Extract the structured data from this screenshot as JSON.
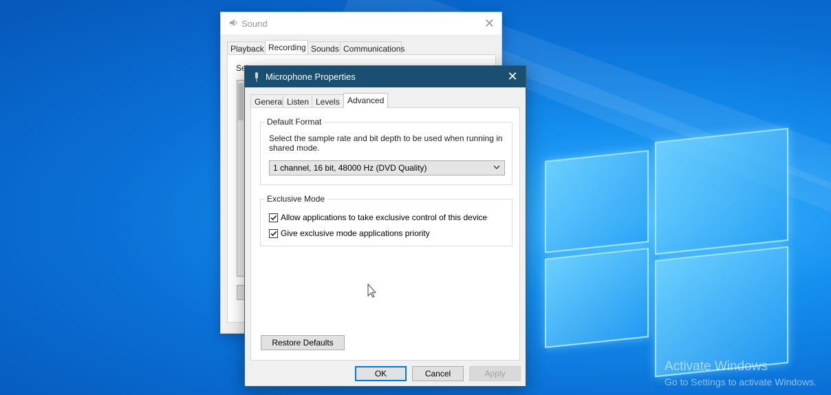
{
  "desktop": {
    "watermark_title": "Activate Windows",
    "watermark_subtitle": "Go to Settings to activate Windows."
  },
  "sound_window": {
    "title": "Sound",
    "tabs": [
      {
        "label": "Playback"
      },
      {
        "label": "Recording"
      },
      {
        "label": "Sounds"
      },
      {
        "label": "Communications"
      }
    ],
    "active_tab": "Recording",
    "partial_text": "Sel"
  },
  "mic_dialog": {
    "title": "Microphone Properties",
    "tabs": [
      {
        "label": "General"
      },
      {
        "label": "Listen"
      },
      {
        "label": "Levels"
      },
      {
        "label": "Advanced"
      }
    ],
    "active_tab": "Advanced",
    "default_format": {
      "legend": "Default Format",
      "description": "Select the sample rate and bit depth to be used when running in shared mode.",
      "selected_value": "1 channel, 16 bit, 48000 Hz (DVD Quality)"
    },
    "exclusive_mode": {
      "legend": "Exclusive Mode",
      "options": [
        {
          "label": "Allow applications to take exclusive control of this device",
          "checked": true
        },
        {
          "label": "Give exclusive mode applications priority",
          "checked": true
        }
      ]
    },
    "buttons": {
      "restore_defaults": "Restore Defaults",
      "ok": "OK",
      "cancel": "Cancel",
      "apply": "Apply"
    }
  },
  "colors": {
    "titlebar": "#1b4f72",
    "desktop_blue": "#0a6fd6",
    "focus_blue": "#0078d7"
  }
}
